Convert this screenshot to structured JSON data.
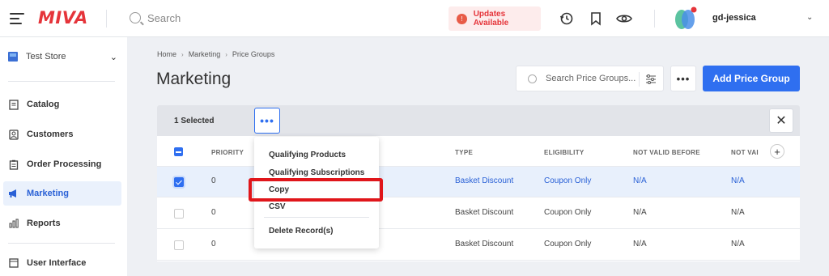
{
  "topbar": {
    "logo": "MIVA",
    "search_placeholder": "Search",
    "updates_label": "Updates Available",
    "username": "gd-jessica",
    "icons": [
      "menu-icon",
      "search-icon",
      "alert-icon",
      "history-icon",
      "bookmark-icon",
      "eye-icon",
      "avatar",
      "chevron-down-icon"
    ]
  },
  "sidebar": {
    "store": "Test Store",
    "items": [
      {
        "label": "Catalog",
        "icon": "catalog-icon"
      },
      {
        "label": "Customers",
        "icon": "customers-icon"
      },
      {
        "label": "Order Processing",
        "icon": "order-icon"
      },
      {
        "label": "Marketing",
        "icon": "marketing-icon",
        "active": true
      },
      {
        "label": "Reports",
        "icon": "reports-icon"
      },
      {
        "label": "User Interface",
        "icon": "ui-icon"
      }
    ]
  },
  "main": {
    "breadcrumb": [
      "Home",
      "Marketing",
      "Price Groups"
    ],
    "title": "Marketing",
    "search_placeholder": "Search Price Groups...",
    "more_label": "•••",
    "add_button": "Add Price Group"
  },
  "selection": {
    "count_label": "1 Selected",
    "more_label": "•••",
    "close_label": "✕"
  },
  "table": {
    "columns": [
      "PRIORITY",
      "TYPE",
      "ELIGIBILITY",
      "NOT VALID BEFORE",
      "NOT VAI"
    ],
    "add_column_label": "+",
    "rows": [
      {
        "selected": true,
        "priority": "0",
        "type": "Basket Discount",
        "eligibility": "Coupon Only",
        "not_valid_before": "N/A",
        "not_valid_after": "N/A"
      },
      {
        "selected": false,
        "priority": "0",
        "type": "Basket Discount",
        "eligibility": "Coupon Only",
        "not_valid_before": "N/A",
        "not_valid_after": "N/A"
      },
      {
        "selected": false,
        "priority": "0",
        "type": "Basket Discount",
        "eligibility": "Coupon Only",
        "not_valid_before": "N/A",
        "not_valid_after": "N/A"
      }
    ]
  },
  "dropdown": {
    "items": [
      "Qualifying Products",
      "Qualifying Subscriptions",
      "Copy",
      "CSV",
      "Delete Record(s)"
    ],
    "highlighted": "Copy"
  },
  "colors": {
    "accent": "#2f6ff0",
    "brand": "#e5343a",
    "highlight": "#e0161b"
  }
}
